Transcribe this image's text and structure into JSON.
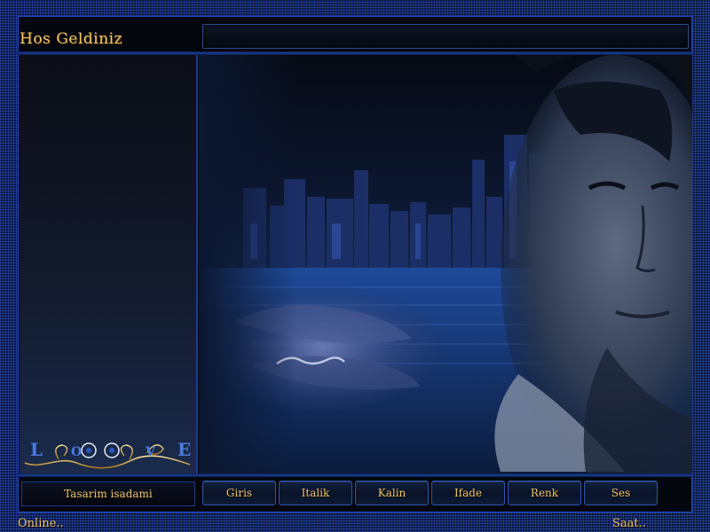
{
  "header": {
    "welcome_text": "Hos Geldiniz",
    "message_text": ""
  },
  "sidebar": {
    "logo_letters": [
      "L",
      "O",
      "V",
      "E"
    ]
  },
  "footer": {
    "credit": "Tasarim isadami",
    "nav_items": [
      "Giris",
      "Italik",
      "Kalin",
      "Ifade",
      "Renk",
      "Ses"
    ]
  },
  "status": {
    "online": "Online..",
    "clock": "Saat.."
  },
  "colors": {
    "gold": "#f2c66a",
    "frame_blue": "#1e4cc0",
    "panel_dark": "#05070f"
  },
  "icons": {
    "main_artwork": "city-portrait-artwork-icon",
    "logo": "love-ornament-icon"
  }
}
